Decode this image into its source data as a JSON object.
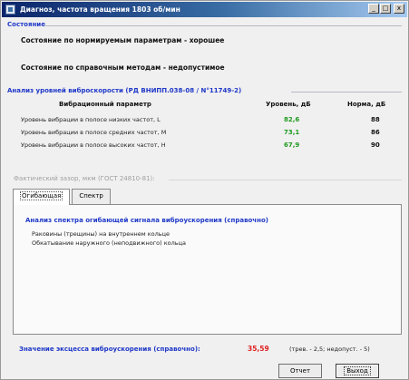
{
  "window": {
    "title": "Диагноз, частота вращения 1803 об/мин",
    "minimize": "_",
    "maximize": "□",
    "close": "x"
  },
  "status": {
    "heading": "Состояние",
    "normalized": "Состояние по нормируемым параметрам - хорошее",
    "reference": "Состояние по справочным методам - недопустимое"
  },
  "vibration": {
    "heading": "Анализ уровней виброскорости (РД ВНИПП.038-08 / N°11749-2)",
    "col_param": "Вибрационный параметр",
    "col_level": "Уровень, дБ",
    "col_norm": "Норма, дБ",
    "rows": [
      {
        "name": "Уровень вибрации в полосе низких частот, L",
        "level": "82,6",
        "norm": "88"
      },
      {
        "name": "Уровень вибрации в полосе средних частот, М",
        "level": "73,1",
        "norm": "86"
      },
      {
        "name": "Уровень вибрации в полосе высоких частот, Н",
        "level": "67,9",
        "norm": "90"
      }
    ]
  },
  "gap_label": "Фактический зазор, мкм (ГОСТ 24810-81):",
  "tabs": [
    {
      "label": "Огибающая",
      "active": true
    },
    {
      "label": "Спектр",
      "active": false
    }
  ],
  "spectrum": {
    "heading": "Анализ спектра огибающей сигнала виброускорения (справочно)",
    "defects": [
      "Раковины (трещины) на внутреннем кольце",
      "Обкатывание наружного (неподвижного) кольца"
    ]
  },
  "excess": {
    "label": "Значение эксцесса виброускорения (справочно):",
    "value": "35,59",
    "note": "(трев. - 2,5; недопуст. - 5)"
  },
  "buttons": {
    "report": "Отчет",
    "exit": "Выход"
  },
  "colors": {
    "section": "#1f38c8",
    "level_ok": "#1e9a1e",
    "alarm": "#e02020"
  }
}
